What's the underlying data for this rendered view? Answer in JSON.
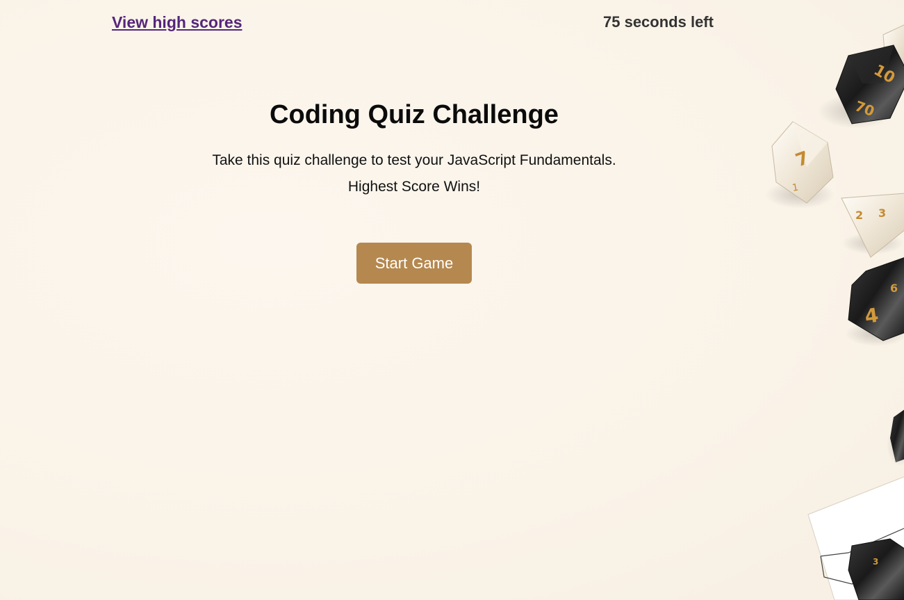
{
  "header": {
    "high_scores_label": "View high scores",
    "timer_text": "75 seconds left"
  },
  "intro": {
    "title": "Coding Quiz Challenge",
    "description_line1": "Take this quiz challenge to test your JavaScript Fundamentals.",
    "description_line2": "Highest Score Wins!"
  },
  "actions": {
    "start_label": "Start Game"
  },
  "colors": {
    "background": "#fbf5ec",
    "link": "#55267a",
    "button": "#b5884f",
    "button_text": "#ffffff"
  },
  "decoration": {
    "dice_numbers": [
      "10",
      "70",
      "1",
      "3",
      "4"
    ]
  }
}
